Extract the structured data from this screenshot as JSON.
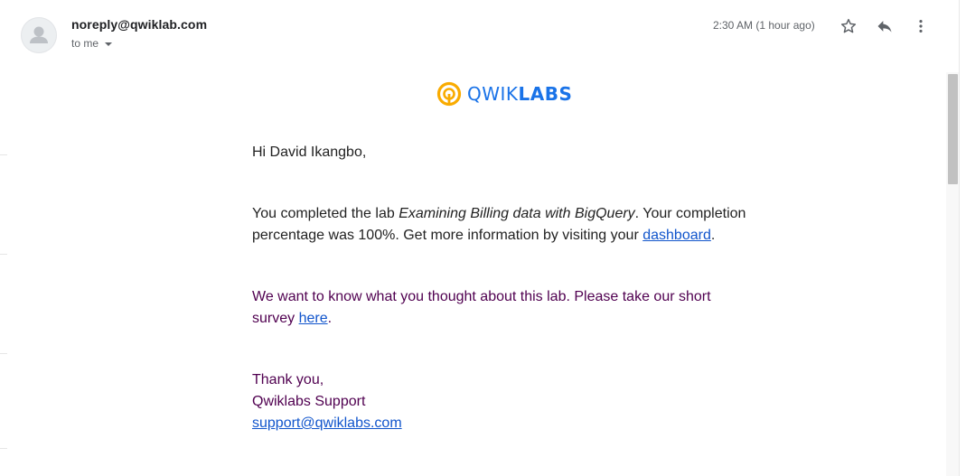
{
  "message": {
    "sender": "noreply@qwiklab.com",
    "recipient_label": "to me",
    "timestamp": "2:30 AM (1 hour ago)"
  },
  "icons": {
    "avatar": "default-user-avatar",
    "star": "star-outline-icon",
    "reply": "reply-arrow-icon",
    "more": "vertical-dots-icon"
  },
  "logo": {
    "text_light": "QWIK",
    "text_bold": "LABS",
    "color_text": "#1a73e8",
    "color_mark": "#f9ab00"
  },
  "email_body": {
    "greeting": "Hi David Ikangbo,",
    "completion_pre": "You completed the lab ",
    "lab_name": "Examining Billing data with BigQuery",
    "completion_mid": ". Your completion",
    "completion_line2": "percentage was 100%. Get more information by visiting your ",
    "dashboard_link": "dashboard",
    "completion_end": ".",
    "survey_line1": "We want to know what you thought about this lab. Please take our short",
    "survey_pre": "survey ",
    "survey_link": "here",
    "survey_end": ".",
    "thanks": "Thank you,",
    "signature": "Qwiklabs Support",
    "support_email": "support@qwiklabs.com"
  },
  "colors": {
    "link": "#1155cc",
    "quoted_text": "#500050",
    "body_text": "#222222",
    "scroll_thumb": "#c1c1c1"
  }
}
